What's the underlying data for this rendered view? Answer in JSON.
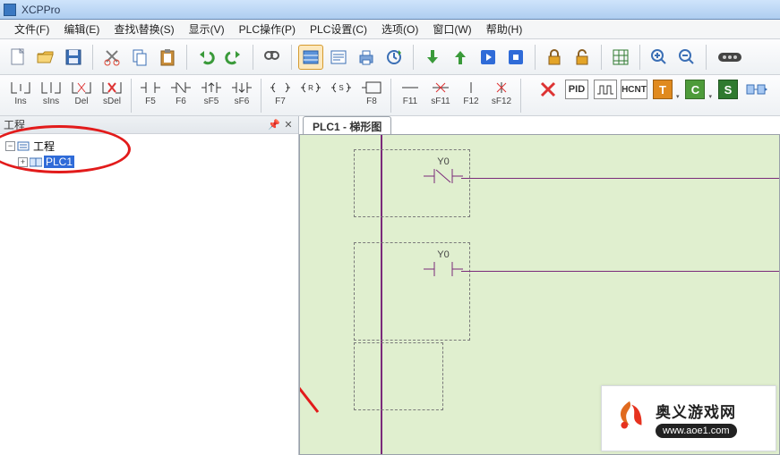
{
  "title": "XCPPro",
  "menu": {
    "file": "文件(F)",
    "edit": "编辑(E)",
    "search": "查找\\替换(S)",
    "view": "显示(V)",
    "plcop": "PLC操作(P)",
    "plccfg": "PLC设置(C)",
    "option": "选项(O)",
    "window": "窗口(W)",
    "help": "帮助(H)"
  },
  "ladbar": {
    "ins": "Ins",
    "sins": "sIns",
    "del": "Del",
    "sdel": "sDel",
    "f5": "F5",
    "f6": "F6",
    "sf5": "sF5",
    "sf6": "sF6",
    "f7": "F7",
    "f8": "F8",
    "f11": "F11",
    "sf11": "sF11",
    "f12": "F12",
    "sf12": "sF12",
    "pid": "PID",
    "hcnt": "HCNT",
    "t": "T",
    "c": "C",
    "s": "S"
  },
  "project": {
    "panelTitle": "工程",
    "root": "工程",
    "plc1": "PLC1"
  },
  "editor": {
    "tabLabel": "PLC1 - 梯形图",
    "contact1": "Y0",
    "contact2": "Y0"
  },
  "watermark": {
    "zh": "奥义游戏网",
    "url": "www.aoe1.com"
  }
}
